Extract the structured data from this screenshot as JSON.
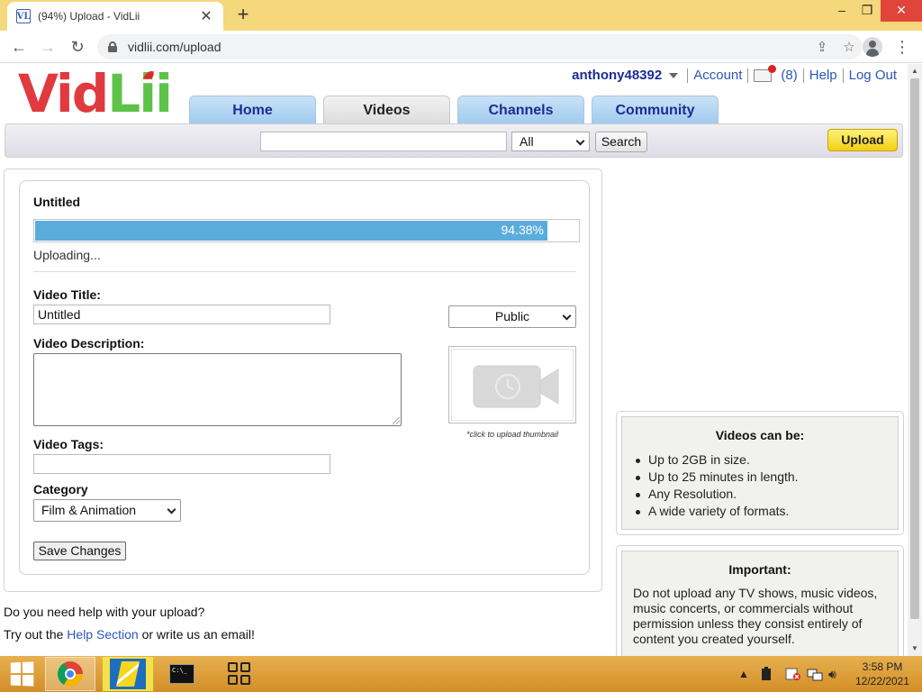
{
  "browser": {
    "tab_title": "(94%) Upload - VidLii",
    "favicon": "VL",
    "new_tab": "+",
    "url": "vidlii.com/upload",
    "controls": {
      "minimize": "–",
      "maximize": "❐",
      "close": "✕"
    }
  },
  "site": {
    "logo": {
      "part1": "Vid",
      "part2": "Lii"
    },
    "user": {
      "username": "anthony48392",
      "account": "Account",
      "mail_count": "(8)",
      "help": "Help",
      "logout": "Log Out"
    },
    "nav": [
      "Home",
      "Videos",
      "Channels",
      "Community"
    ],
    "active_nav": "Videos",
    "search": {
      "query": "",
      "scope": "All",
      "button": "Search"
    },
    "upload_button": "Upload"
  },
  "upload": {
    "file_name": "Untitled",
    "progress_percent": 94.38,
    "progress_label": "94.38%",
    "status": "Uploading...",
    "title_label": "Video Title:",
    "title_value": "Untitled",
    "privacy": "Public",
    "description_label": "Video Description:",
    "description_value": "",
    "thumbnail_caption": "*click to upload thumbnail",
    "tags_label": "Video Tags:",
    "tags_value": "",
    "category_label": "Category",
    "category_value": "Film & Animation",
    "save_button": "Save Changes"
  },
  "help": {
    "line1": "Do you need help with your upload?",
    "line2_prefix": "Try out the ",
    "line2_link": "Help Section",
    "line2_suffix": " or write us an email!"
  },
  "sidebar": {
    "videos_can_be": {
      "title": "Videos can be:",
      "items": [
        "Up to 2GB in size.",
        "Up to 25 minutes in length.",
        "Any Resolution.",
        "A wide variety of formats."
      ]
    },
    "important": {
      "title": "Important:",
      "text": "Do not upload any TV shows, music videos, music concerts, or commercials without permission unless they consist entirely of content you created yourself."
    }
  },
  "taskbar": {
    "time": "3:58 PM",
    "date": "12/22/2021"
  }
}
